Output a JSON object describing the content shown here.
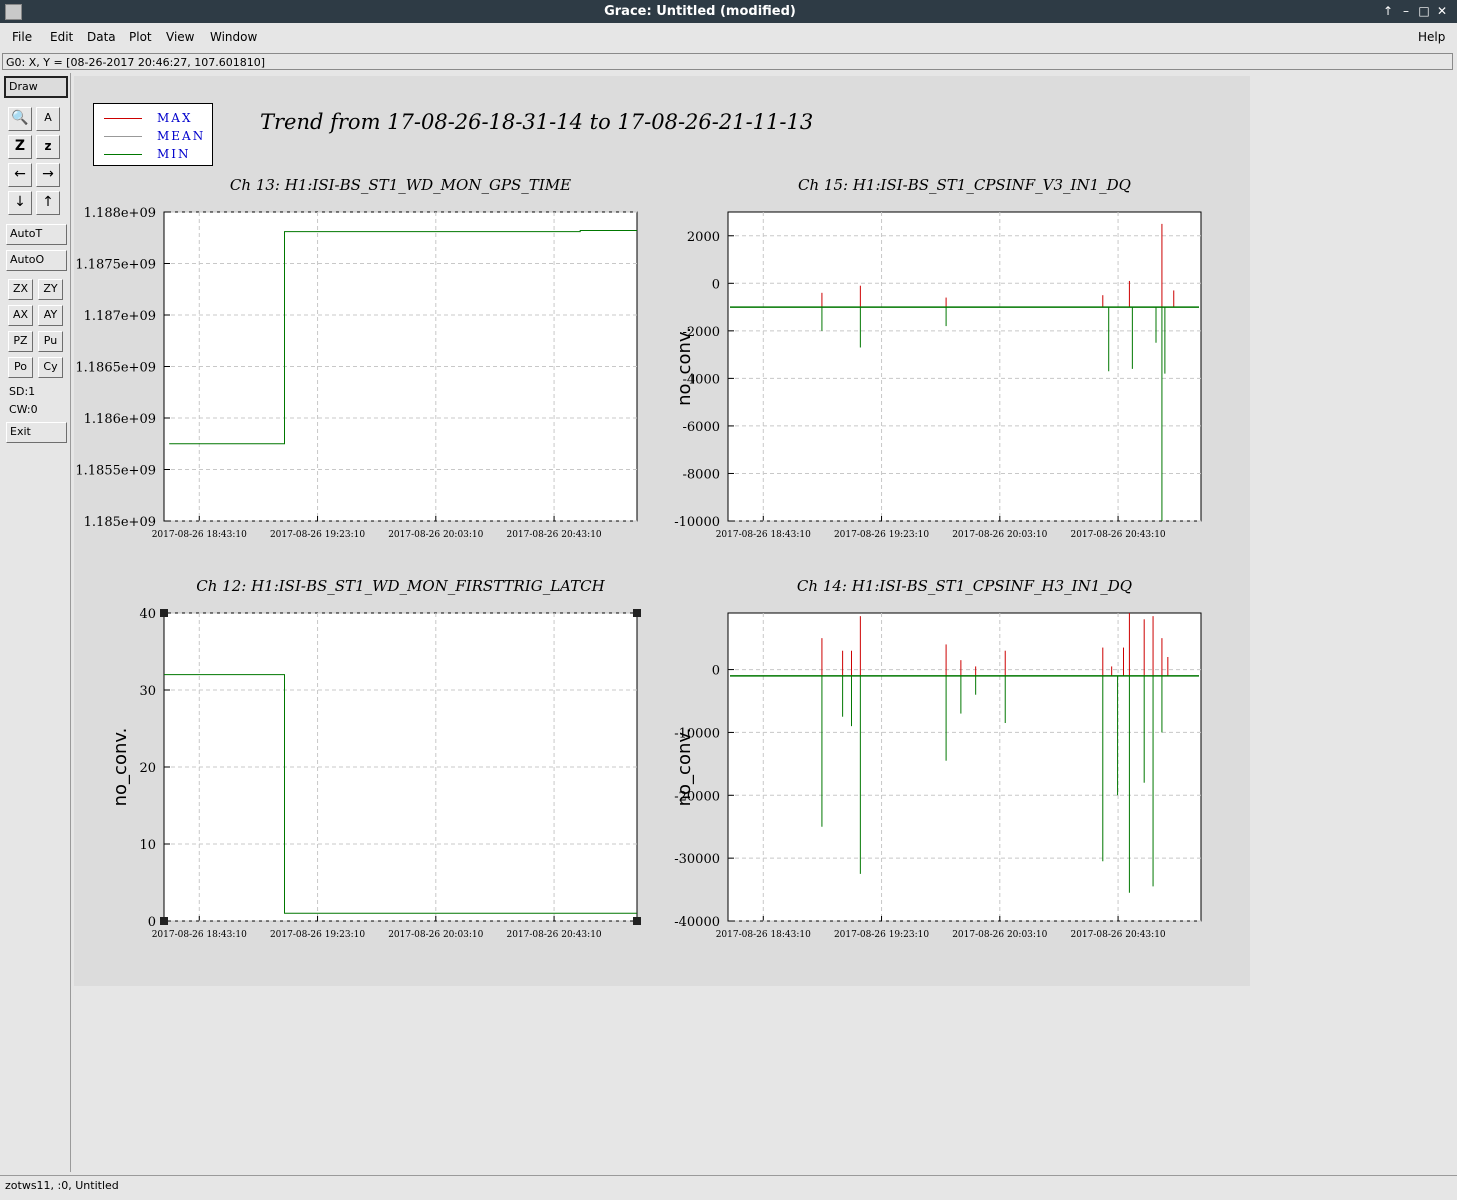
{
  "window": {
    "title": "Grace: Untitled (modified)",
    "controls": [
      "↑",
      "–",
      "□",
      "✕"
    ]
  },
  "menu": {
    "items": [
      "File",
      "Edit",
      "Data",
      "Plot",
      "View",
      "Window"
    ],
    "help": "Help"
  },
  "locator": "G0: X, Y = [08-26-2017 20:46:27, 107.601810]",
  "toolbar": {
    "draw": "Draw",
    "icon_buttons": [
      "zoom-icon",
      "autoscale-text-icon",
      "zoom-x-icon",
      "zoom-y-icon",
      "arrow-left-icon",
      "arrow-right-icon",
      "arrow-down-icon",
      "arrow-up-icon"
    ],
    "autot": "AutoT",
    "autoo": "AutoO",
    "small_buttons": [
      "ZX",
      "ZY",
      "AX",
      "AY",
      "PZ",
      "Pu",
      "Po",
      "Cy"
    ],
    "sd": "SD:1",
    "cw": "CW:0",
    "exit": "Exit"
  },
  "status": "zotws11, :0, Untitled",
  "figure": {
    "title": "Trend from 17-08-26-18-31-14 to 17-08-26-21-11-13",
    "legend": [
      {
        "label": "MAX",
        "color": "#cc0000"
      },
      {
        "label": "MEAN",
        "color": "#999999"
      },
      {
        "label": "MIN",
        "color": "#007700"
      }
    ]
  },
  "chart_data": [
    {
      "type": "line",
      "title": "Ch 13: H1:ISI-BS_ST1_WD_MON_GPS_TIME",
      "ylabel": "",
      "x_ticks": [
        "2017-08-26 18:43:10",
        "2017-08-26 19:23:10",
        "2017-08-26 20:03:10",
        "2017-08-26 20:43:10"
      ],
      "y_ticks": [
        "1.185e+09",
        "1.1855e+09",
        "1.186e+09",
        "1.1865e+09",
        "1.187e+09",
        "1.1875e+09",
        "1.188e+09"
      ],
      "ylim": [
        1185000000,
        1188000000
      ],
      "xlim": [
        "2017-08-26 18:31:14",
        "2017-08-26 21:11:13"
      ],
      "series": [
        {
          "name": "MIN",
          "color": "#007700",
          "points": [
            [
              "2017-08-26 18:33:00",
              1185750000
            ],
            [
              "2017-08-26 19:12:00",
              1185750000
            ],
            [
              "2017-08-26 19:12:00",
              1187810000
            ],
            [
              "2017-08-26 20:52:00",
              1187810000
            ],
            [
              "2017-08-26 20:52:00",
              1187820000
            ],
            [
              "2017-08-26 21:11:13",
              1187820000
            ]
          ]
        }
      ]
    },
    {
      "type": "line",
      "title": "Ch 15: H1:ISI-BS_ST1_CPSINF_V3_IN1_DQ",
      "ylabel": "no_conv.",
      "x_ticks": [
        "2017-08-26 18:43:10",
        "2017-08-26 19:23:10",
        "2017-08-26 20:03:10",
        "2017-08-26 20:43:10"
      ],
      "y_ticks": [
        "-10000",
        "-8000",
        "-6000",
        "-4000",
        "-2000",
        "0",
        "2000"
      ],
      "ylim": [
        -10000,
        3000
      ],
      "xlim": [
        "2017-08-26 18:31:14",
        "2017-08-26 21:11:13"
      ],
      "baseline": -1000,
      "spikes_max": [
        [
          "2017-08-26 19:03:00",
          -400
        ],
        [
          "2017-08-26 19:16:00",
          -100
        ],
        [
          "2017-08-26 19:45:00",
          -600
        ],
        [
          "2017-08-26 20:38:00",
          -500
        ],
        [
          "2017-08-26 20:47:00",
          100
        ],
        [
          "2017-08-26 20:58:00",
          2500
        ],
        [
          "2017-08-26 21:02:00",
          -300
        ]
      ],
      "spikes_min": [
        [
          "2017-08-26 19:03:00",
          -2000
        ],
        [
          "2017-08-26 19:16:00",
          -2700
        ],
        [
          "2017-08-26 19:45:00",
          -1800
        ],
        [
          "2017-08-26 20:40:00",
          -3700
        ],
        [
          "2017-08-26 20:48:00",
          -3600
        ],
        [
          "2017-08-26 20:56:00",
          -2500
        ],
        [
          "2017-08-26 20:58:00",
          -10000
        ],
        [
          "2017-08-26 20:59:00",
          -3800
        ]
      ]
    },
    {
      "type": "line",
      "title": "Ch 12: H1:ISI-BS_ST1_WD_MON_FIRSTTRIG_LATCH",
      "ylabel": "no_conv.",
      "x_ticks": [
        "2017-08-26 18:43:10",
        "2017-08-26 19:23:10",
        "2017-08-26 20:03:10",
        "2017-08-26 20:43:10"
      ],
      "y_ticks": [
        "0",
        "10",
        "20",
        "30",
        "40"
      ],
      "ylim": [
        0,
        40
      ],
      "xlim": [
        "2017-08-26 18:31:14",
        "2017-08-26 21:11:13"
      ],
      "series": [
        {
          "name": "MIN",
          "color": "#007700",
          "points": [
            [
              "2017-08-26 18:31:14",
              32
            ],
            [
              "2017-08-26 19:12:00",
              32
            ],
            [
              "2017-08-26 19:12:00",
              1
            ],
            [
              "2017-08-26 21:11:13",
              1
            ]
          ]
        }
      ]
    },
    {
      "type": "line",
      "title": "Ch 14: H1:ISI-BS_ST1_CPSINF_H3_IN1_DQ",
      "ylabel": "no_conv.",
      "x_ticks": [
        "2017-08-26 18:43:10",
        "2017-08-26 19:23:10",
        "2017-08-26 20:03:10",
        "2017-08-26 20:43:10"
      ],
      "y_ticks": [
        "-40000",
        "-30000",
        "-20000",
        "-10000",
        "0"
      ],
      "ylim": [
        -40000,
        9000
      ],
      "xlim": [
        "2017-08-26 18:31:14",
        "2017-08-26 21:11:13"
      ],
      "baseline": -1000,
      "spikes_max": [
        [
          "2017-08-26 19:03:00",
          5000
        ],
        [
          "2017-08-26 19:10:00",
          3000
        ],
        [
          "2017-08-26 19:13:00",
          3000
        ],
        [
          "2017-08-26 19:16:00",
          8500
        ],
        [
          "2017-08-26 19:45:00",
          4000
        ],
        [
          "2017-08-26 19:50:00",
          1500
        ],
        [
          "2017-08-26 19:55:00",
          500
        ],
        [
          "2017-08-26 20:05:00",
          3000
        ],
        [
          "2017-08-26 20:38:00",
          3500
        ],
        [
          "2017-08-26 20:41:00",
          500
        ],
        [
          "2017-08-26 20:45:00",
          3500
        ],
        [
          "2017-08-26 20:47:00",
          9000
        ],
        [
          "2017-08-26 20:52:00",
          8000
        ],
        [
          "2017-08-26 20:55:00",
          8500
        ],
        [
          "2017-08-26 20:58:00",
          5000
        ],
        [
          "2017-08-26 21:00:00",
          2000
        ]
      ],
      "spikes_min": [
        [
          "2017-08-26 19:03:00",
          -25000
        ],
        [
          "2017-08-26 19:10:00",
          -7500
        ],
        [
          "2017-08-26 19:13:00",
          -9000
        ],
        [
          "2017-08-26 19:16:00",
          -32500
        ],
        [
          "2017-08-26 19:45:00",
          -14500
        ],
        [
          "2017-08-26 19:50:00",
          -7000
        ],
        [
          "2017-08-26 19:55:00",
          -4000
        ],
        [
          "2017-08-26 20:05:00",
          -8500
        ],
        [
          "2017-08-26 20:38:00",
          -30500
        ],
        [
          "2017-08-26 20:43:00",
          -20000
        ],
        [
          "2017-08-26 20:47:00",
          -35500
        ],
        [
          "2017-08-26 20:52:00",
          -18000
        ],
        [
          "2017-08-26 20:55:00",
          -34500
        ],
        [
          "2017-08-26 20:58:00",
          -10000
        ]
      ]
    }
  ]
}
